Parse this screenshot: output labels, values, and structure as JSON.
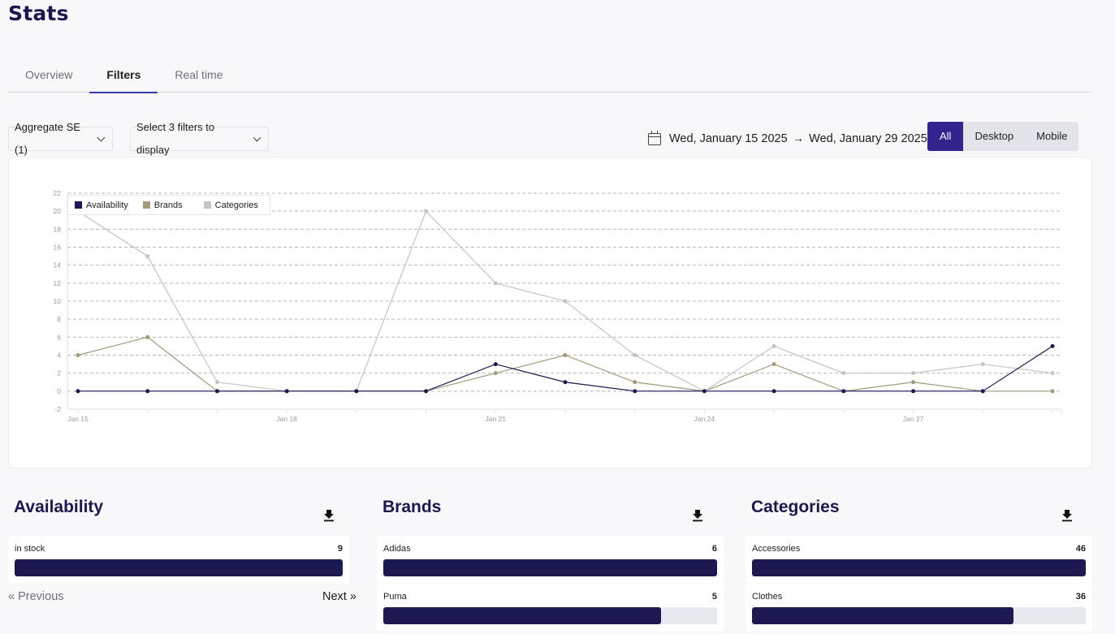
{
  "page": {
    "title": "Stats"
  },
  "tabs": [
    {
      "label": "Overview",
      "active": false
    },
    {
      "label": "Filters",
      "active": true
    },
    {
      "label": "Real time",
      "active": false
    }
  ],
  "filters": {
    "aggregate_label": "Aggregate SE (1)",
    "select_filters_label": "Select 3 filters to display"
  },
  "date_range": {
    "start": "Wed, January 15 2025",
    "arrow": "→",
    "end": "Wed, January 29 2025"
  },
  "device_toggle": {
    "options": [
      "All",
      "Desktop",
      "Mobile"
    ],
    "selected": "All"
  },
  "chart_data": {
    "type": "line",
    "title": "",
    "xlabel": "",
    "ylabel": "",
    "x": [
      "Jan 15",
      "Jan 16",
      "Jan 17",
      "Jan 18",
      "Jan 19",
      "Jan 20",
      "Jan 21",
      "Jan 22",
      "Jan 23",
      "Jan 24",
      "Jan 25",
      "Jan 26",
      "Jan 27",
      "Jan 28",
      "Jan 29"
    ],
    "x_tick_labels": [
      "Jan 15",
      "Jan 18",
      "Jan 21",
      "Jan 24",
      "Jan 27"
    ],
    "y_ticks": [
      -2,
      0,
      2,
      4,
      6,
      8,
      10,
      12,
      14,
      16,
      18,
      20,
      22
    ],
    "ylim": [
      -2,
      22
    ],
    "grid": true,
    "legend_position": "top-left",
    "series": [
      {
        "name": "Availability",
        "color": "#1c1850",
        "values": [
          0,
          0,
          0,
          0,
          0,
          0,
          3,
          1,
          0,
          0,
          0,
          0,
          0,
          0,
          5
        ]
      },
      {
        "name": "Brands",
        "color": "#a39a7c",
        "values": [
          4,
          6,
          0,
          0,
          0,
          0,
          2,
          4,
          1,
          0,
          3,
          0,
          1,
          0,
          0
        ]
      },
      {
        "name": "Categories",
        "color": "#c4c4c4",
        "values": [
          20,
          15,
          1,
          0,
          0,
          20,
          12,
          10,
          4,
          0,
          5,
          2,
          2,
          3,
          2
        ]
      }
    ]
  },
  "panels": [
    {
      "title": "Availability",
      "items": [
        {
          "label": "in stock",
          "value": "9",
          "fraction": 1.0
        }
      ],
      "pagination": {
        "previous": "« Previous",
        "next": "Next »"
      }
    },
    {
      "title": "Brands",
      "items": [
        {
          "label": "Adidas",
          "value": "6",
          "fraction": 1.0
        },
        {
          "label": "Puma",
          "value": "5",
          "fraction": 0.833
        }
      ]
    },
    {
      "title": "Categories",
      "items": [
        {
          "label": "Accessories",
          "value": "46",
          "fraction": 1.0
        },
        {
          "label": "Clothes",
          "value": "36",
          "fraction": 0.783
        }
      ]
    }
  ],
  "colors": {
    "accent": "#32248f",
    "bar": "#1c1850",
    "title": "#1b1850"
  }
}
